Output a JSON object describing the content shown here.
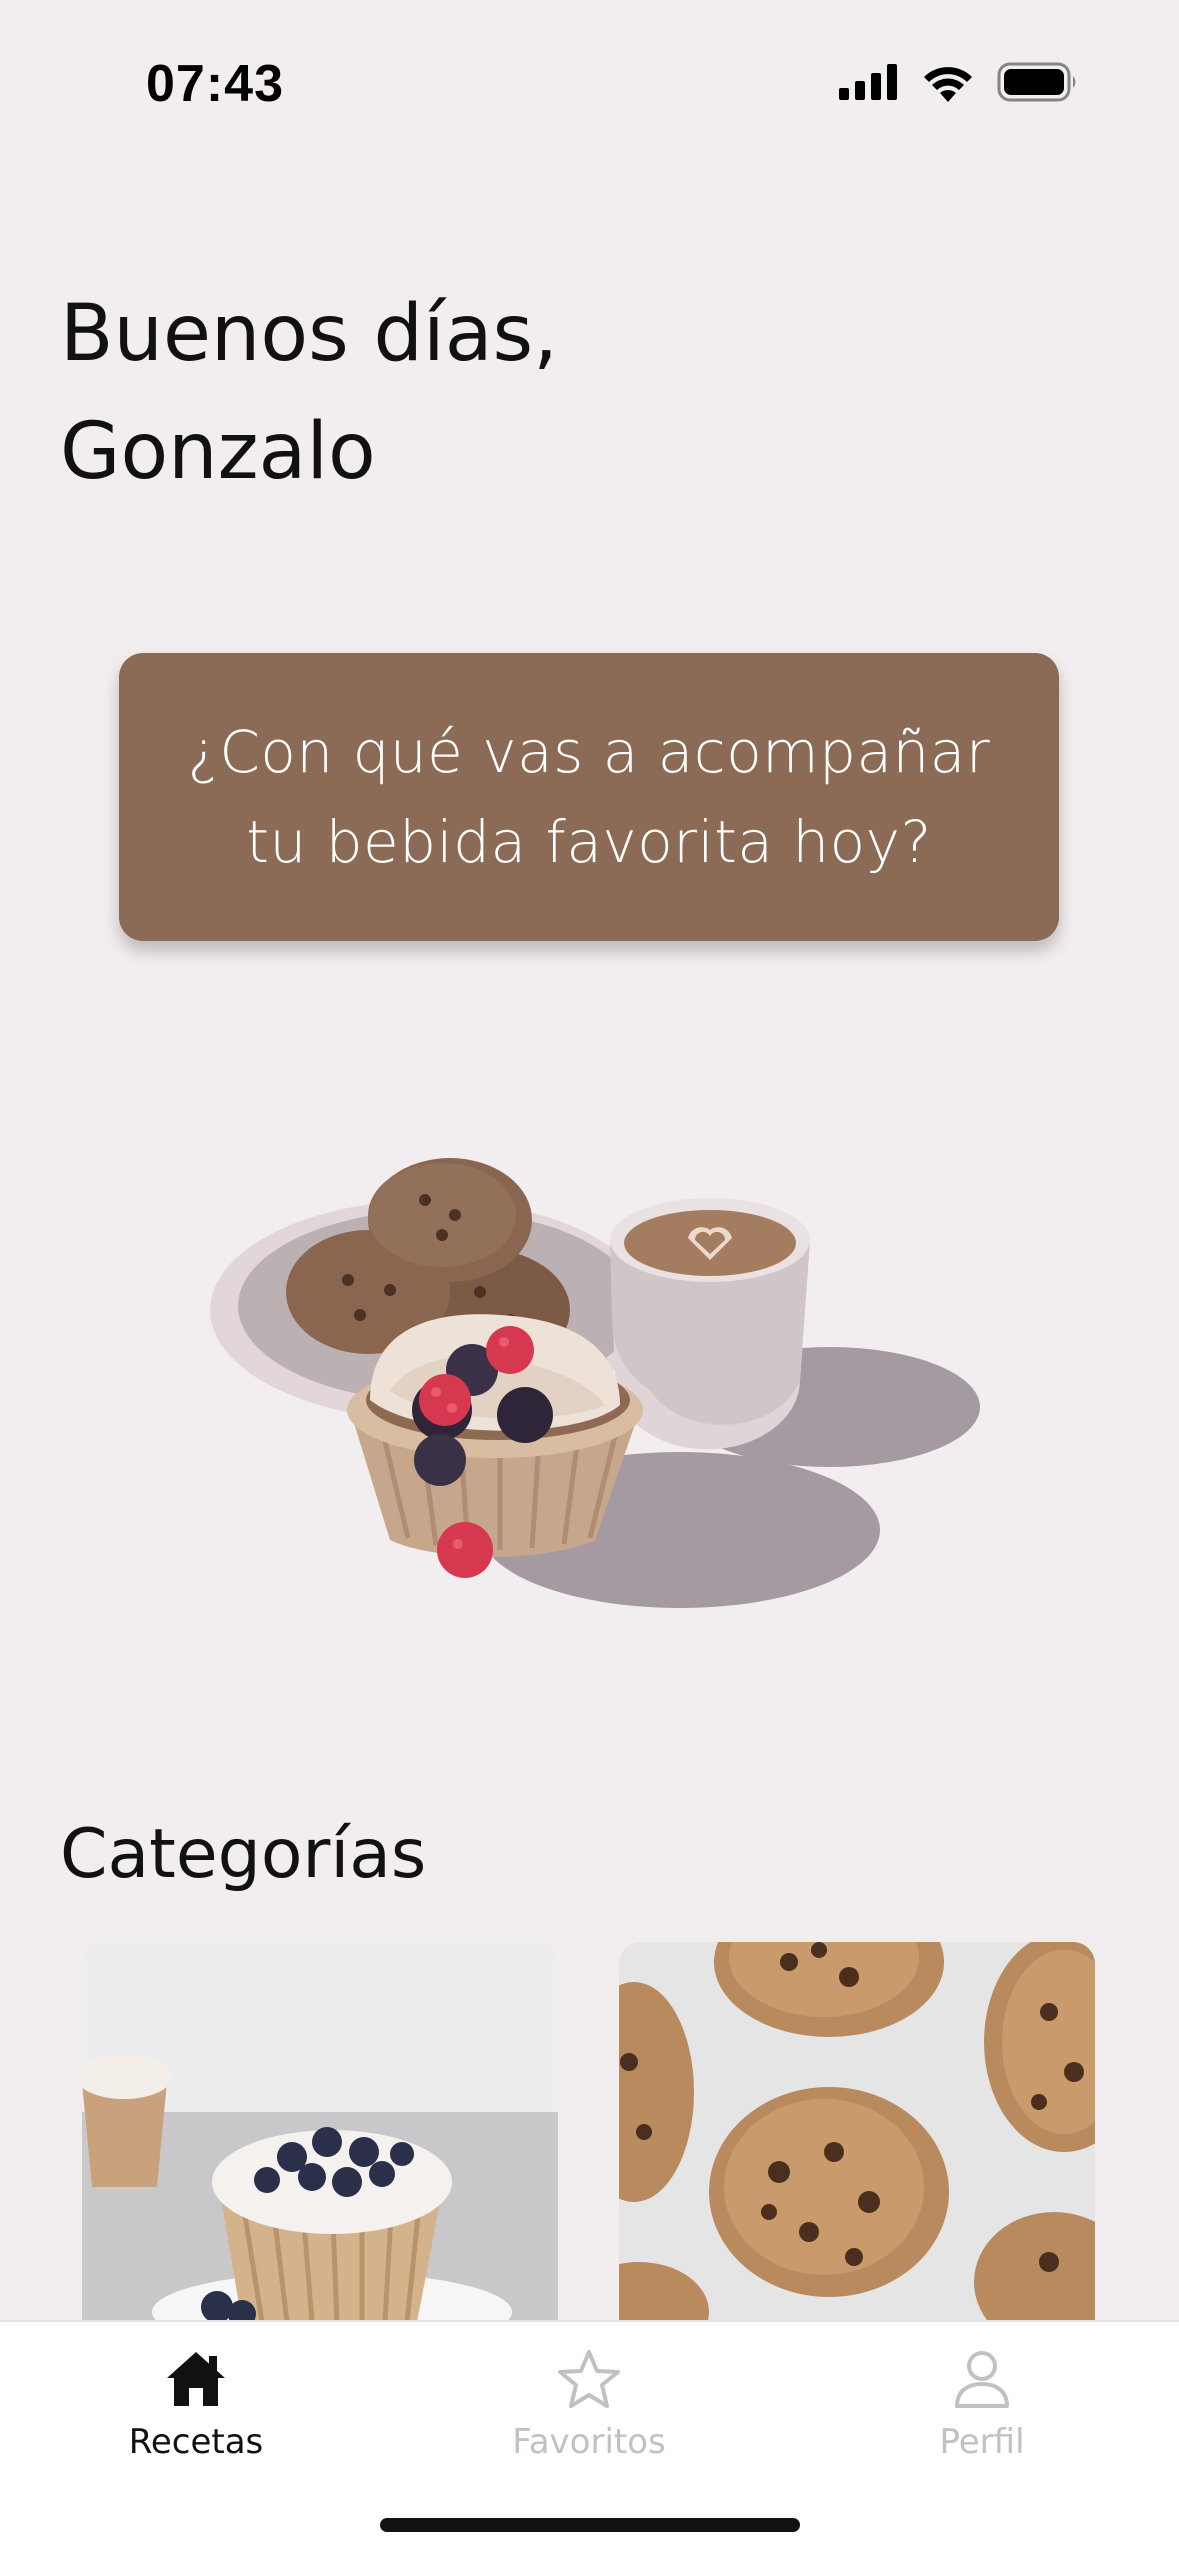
{
  "status_bar": {
    "time": "07:43",
    "icons": [
      "cellular-signal-icon",
      "wifi-icon",
      "battery-icon"
    ]
  },
  "greeting": {
    "line1": "Buenos días,",
    "line2": "Gonzalo"
  },
  "prompt_card": {
    "text": "¿Con qué vas a acompañar tu bebida favorita hoy?",
    "background": "#8B6B55"
  },
  "illustration": {
    "icon": "coffee-and-pastries-illustration"
  },
  "categories": {
    "title": "Categorías",
    "items": [
      {
        "image": "blueberry-muffins-photo"
      },
      {
        "image": "chocolate-chip-cookies-photo"
      }
    ]
  },
  "tab_bar": {
    "tabs": [
      {
        "label": "Recetas",
        "icon": "home-icon",
        "active": true
      },
      {
        "label": "Favoritos",
        "icon": "star-icon",
        "active": false
      },
      {
        "label": "Perfil",
        "icon": "person-icon",
        "active": false
      }
    ],
    "active_color": "#111111",
    "inactive_color": "#C4C0C2"
  }
}
